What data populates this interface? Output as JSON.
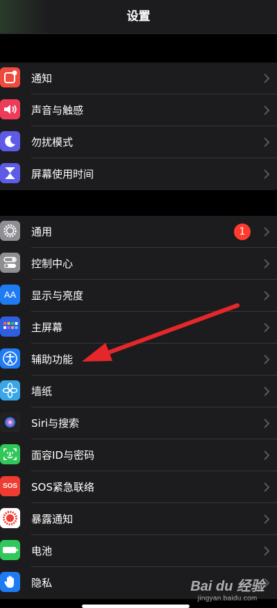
{
  "header": {
    "title": "设置"
  },
  "groups": [
    {
      "items": [
        {
          "key": "notifications",
          "label": "通知",
          "icon": "notifications-icon",
          "color": "#ef4b3d"
        },
        {
          "key": "sounds",
          "label": "声音与触感",
          "icon": "speaker-icon",
          "color": "#ef3b5a"
        },
        {
          "key": "dnd",
          "label": "勿扰模式",
          "icon": "moon-icon",
          "color": "#5e5ce6"
        },
        {
          "key": "screen-time",
          "label": "屏幕使用时间",
          "icon": "hourglass-icon",
          "color": "#5e5ce6"
        }
      ]
    },
    {
      "items": [
        {
          "key": "general",
          "label": "通用",
          "icon": "gear-icon",
          "color": "#8e8e93",
          "badge": "1"
        },
        {
          "key": "control-center",
          "label": "控制中心",
          "icon": "toggles-icon",
          "color": "#8e8e93"
        },
        {
          "key": "display",
          "label": "显示与亮度",
          "icon": "text-size-icon",
          "color": "#1f7bf2",
          "icon_text": "AA"
        },
        {
          "key": "home-screen",
          "label": "主屏幕",
          "icon": "home-grid-icon",
          "color": "#2f5fe0"
        },
        {
          "key": "accessibility",
          "label": "辅助功能",
          "icon": "accessibility-icon",
          "color": "#1f7bf2"
        },
        {
          "key": "wallpaper",
          "label": "墙纸",
          "icon": "flower-icon",
          "color": "#39a6e8"
        },
        {
          "key": "siri",
          "label": "Siri与搜索",
          "icon": "siri-icon",
          "color": "#222"
        },
        {
          "key": "face-id",
          "label": "面容ID与密码",
          "icon": "face-id-icon",
          "color": "#32c75a"
        },
        {
          "key": "sos",
          "label": "SOS紧急联络",
          "icon": "sos-icon",
          "color": "#ef3b30",
          "icon_text": "SOS"
        },
        {
          "key": "exposure",
          "label": "暴露通知",
          "icon": "exposure-icon",
          "color": "#fff"
        },
        {
          "key": "battery",
          "label": "电池",
          "icon": "battery-icon",
          "color": "#32c75a"
        },
        {
          "key": "privacy",
          "label": "隐私",
          "icon": "hand-icon",
          "color": "#1f7bf2"
        }
      ]
    }
  ],
  "annotation": {
    "arrow_color": "#e5272b"
  },
  "watermark": {
    "brand": "Bai du 经验",
    "url": "jingyan.baidu.com"
  }
}
